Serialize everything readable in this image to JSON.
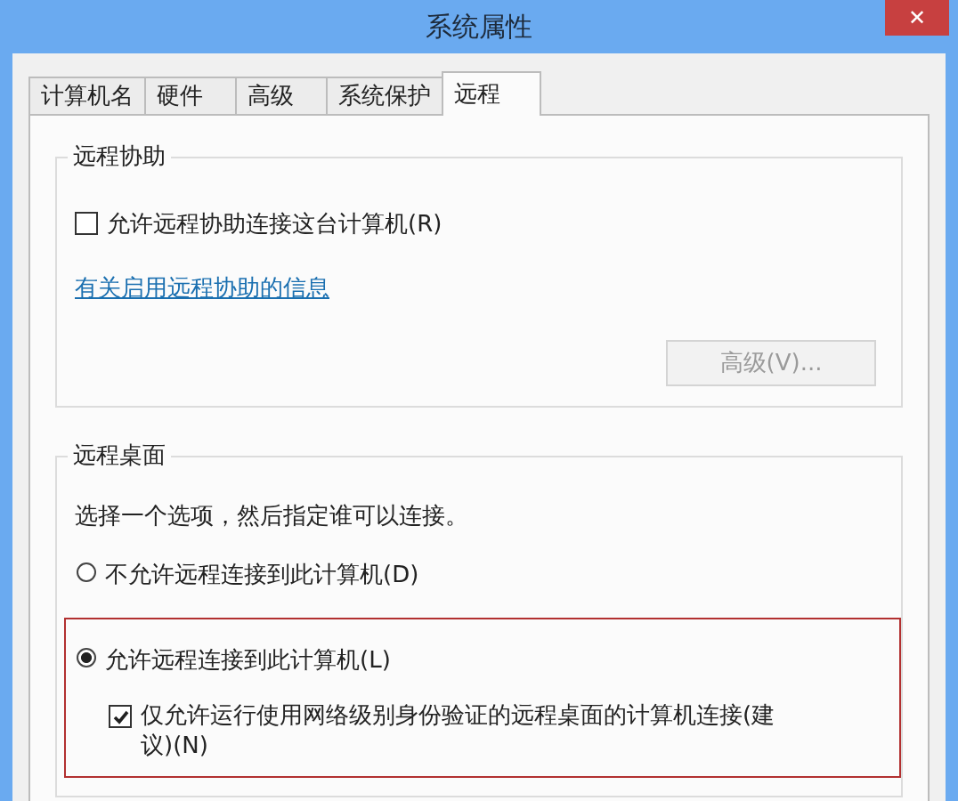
{
  "window": {
    "title": "系统属性",
    "close": "✕"
  },
  "tabs": [
    {
      "label": "计算机名",
      "selected": false
    },
    {
      "label": "硬件",
      "selected": false
    },
    {
      "label": "高级",
      "selected": false
    },
    {
      "label": "系统保护",
      "selected": false
    },
    {
      "label": "远程",
      "selected": true
    }
  ],
  "remote_assistance": {
    "title": "远程协助",
    "checkbox": {
      "label": "允许远程协助连接这台计算机(R)",
      "checked": false
    },
    "link": "有关启用远程协助的信息",
    "button": {
      "label": "高级(V)...",
      "disabled": true
    }
  },
  "remote_desktop": {
    "title": "远程桌面",
    "instruction": "选择一个选项，然后指定谁可以连接。",
    "options": [
      {
        "label": "不允许远程连接到此计算机(D)",
        "selected": false,
        "highlighted": false
      },
      {
        "label": "允许远程连接到此计算机(L)",
        "selected": true,
        "highlighted": true,
        "sub_checkbox": {
          "label": "仅允许运行使用网络级别身份验证的远程桌面的计算机连接(建议)(N)",
          "checked": true
        }
      }
    ]
  }
}
